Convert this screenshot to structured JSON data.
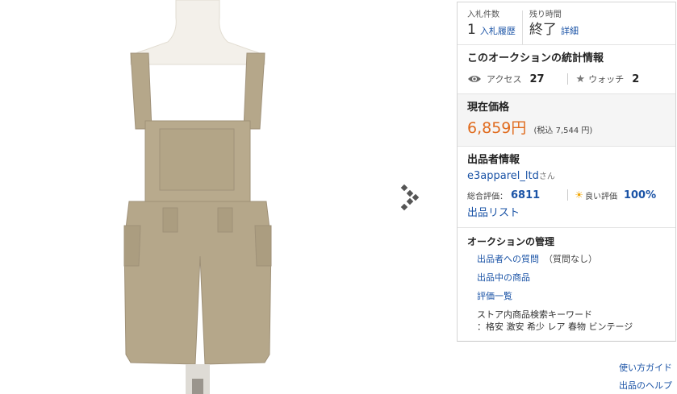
{
  "bids": {
    "label": "入札件数",
    "count": "1",
    "link": "入札履歴"
  },
  "time_left": {
    "label": "残り時間",
    "value": "終了",
    "link": "詳細"
  },
  "stats": {
    "title": "このオークションの統計情報",
    "access_label": "アクセス",
    "access_count": "27",
    "watch_label": "ウォッチ",
    "watch_count": "2"
  },
  "price": {
    "title": "現在価格",
    "value": "6,859円",
    "tax_note": "(税込 7,544 円)"
  },
  "seller": {
    "title": "出品者情報",
    "name": "e3apparel_ltd",
    "honorific": "さん",
    "total_label": "総合評価：",
    "total_value": "6811",
    "good_label": "良い評価",
    "good_value": "100%",
    "list_link": "出品リスト"
  },
  "management": {
    "title": "オークションの管理",
    "question_link": "出品者への質問",
    "question_note": "（質問なし）",
    "listing_link": "出品中の商品",
    "rating_link": "評価一覧",
    "keyword_line1": "ストア内商品検索キーワード",
    "keyword_line2": "：格安 激安 希少 レア 春物 ビンテージ"
  },
  "footer": {
    "guide": "使い方ガイド",
    "help": "出品のヘルプ"
  },
  "icons": {
    "eye": "eye-icon",
    "star": "star-icon",
    "sun": "sun-icon",
    "next": "next-image-arrow-icon"
  },
  "colors": {
    "link": "#1a53a6",
    "price": "#e06a1c",
    "garment": "#b5a78a"
  }
}
